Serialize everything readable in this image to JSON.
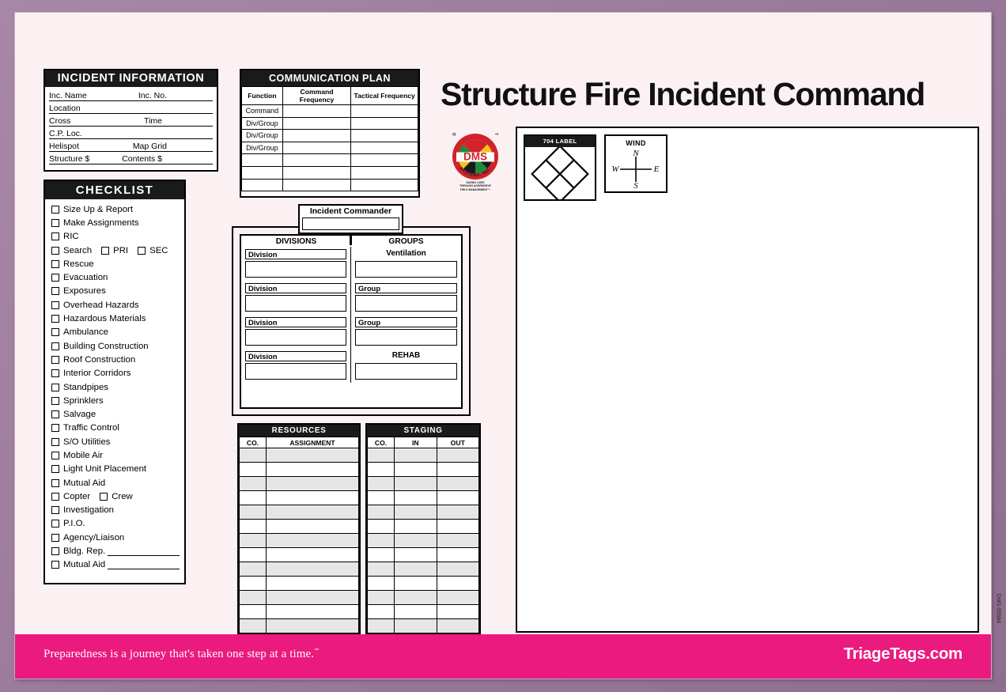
{
  "document": {
    "title": "Structure Fire Incident Command",
    "doc_number": "DMS-05584"
  },
  "incident_information": {
    "header": "INCIDENT INFORMATION",
    "rows": [
      {
        "label": "Inc. Name",
        "label2": "Inc. No."
      },
      {
        "label": "Location",
        "label2": ""
      },
      {
        "label": "Cross",
        "label2": "Time"
      },
      {
        "label": "C.P. Loc.",
        "label2": ""
      },
      {
        "label": "Helispot",
        "label2": "Map Grid"
      },
      {
        "label": "Structure $",
        "label2": "Contents $"
      }
    ]
  },
  "communication_plan": {
    "header": "COMMUNICATION PLAN",
    "columns": [
      "Function",
      "Command Frequency",
      "Tactical Frequency"
    ],
    "rows": [
      "Command",
      "Div/Group",
      "Div/Group",
      "Div/Group",
      "",
      "",
      ""
    ]
  },
  "checklist": {
    "header": "CHECKLIST",
    "items": [
      {
        "label": "Size Up & Report"
      },
      {
        "label": "Make Assignments"
      },
      {
        "label": "RIC"
      },
      {
        "label": "Search",
        "extra_checkboxes": [
          "PRI",
          "SEC"
        ]
      },
      {
        "label": "Rescue"
      },
      {
        "label": "Evacuation"
      },
      {
        "label": "Exposures"
      },
      {
        "label": "Overhead Hazards"
      },
      {
        "label": "Hazardous Materials"
      },
      {
        "label": "Ambulance"
      },
      {
        "label": "Building Construction"
      },
      {
        "label": "Roof Construction"
      },
      {
        "label": "Interior Corridors"
      },
      {
        "label": "Standpipes"
      },
      {
        "label": "Sprinklers"
      },
      {
        "label": "Salvage"
      },
      {
        "label": "Traffic Control"
      },
      {
        "label": "S/O Utilities"
      },
      {
        "label": "Mobile Air"
      },
      {
        "label": "Light Unit Placement"
      },
      {
        "label": "Mutual Aid"
      },
      {
        "label": "Copter",
        "extra_checkboxes": [
          "Crew"
        ]
      },
      {
        "label": "Investigation"
      },
      {
        "label": "P.I.O."
      },
      {
        "label": "Agency/Liaison"
      },
      {
        "label": "Bldg. Rep.",
        "write_in": true
      },
      {
        "label": "Mutual Aid",
        "write_in": true
      }
    ]
  },
  "org_chart": {
    "commander_label": "Incident Commander",
    "divisions_header": "DIVISIONS",
    "groups_header": "GROUPS",
    "divisions": [
      "Division",
      "Division",
      "Division",
      "Division"
    ],
    "groups": [
      "Ventilation",
      "Group",
      "Group",
      "REHAB"
    ],
    "groups_centered": [
      true,
      false,
      false,
      true
    ]
  },
  "resources": {
    "header": "RESOURCES",
    "columns": [
      "CO.",
      "ASSIGNMENT"
    ],
    "row_count": 13
  },
  "staging": {
    "header": "STAGING",
    "columns": [
      "CO.",
      "IN",
      "OUT"
    ],
    "row_count": 13
  },
  "logo": {
    "center_text": "DMS",
    "ring_top_text": "DISASTER MANAGEMENT",
    "ring_bottom_text": "SYSTEMS, INC.",
    "tagline_line1": "SAVING LIVES",
    "tagline_line2": "THROUGH AGGRESSIVE",
    "tagline_line3": "FIELD MANAGEMENT™"
  },
  "sketch_area": {
    "label704_header": "704 LABEL",
    "wind_title": "WIND",
    "compass": {
      "north": "N",
      "south": "S",
      "east": "E",
      "west": "W"
    }
  },
  "footer": {
    "tagline": "Preparedness is a journey that's taken one step at a time.",
    "tagline_mark": "℠",
    "brand": "TriageTags.com",
    "background_color": "#eb1a7e"
  },
  "colors": {
    "frame": "#9b7a9b",
    "paper": "#fbf1f3",
    "header_black": "#1a1a1a",
    "footer_pink": "#eb1a7e"
  }
}
